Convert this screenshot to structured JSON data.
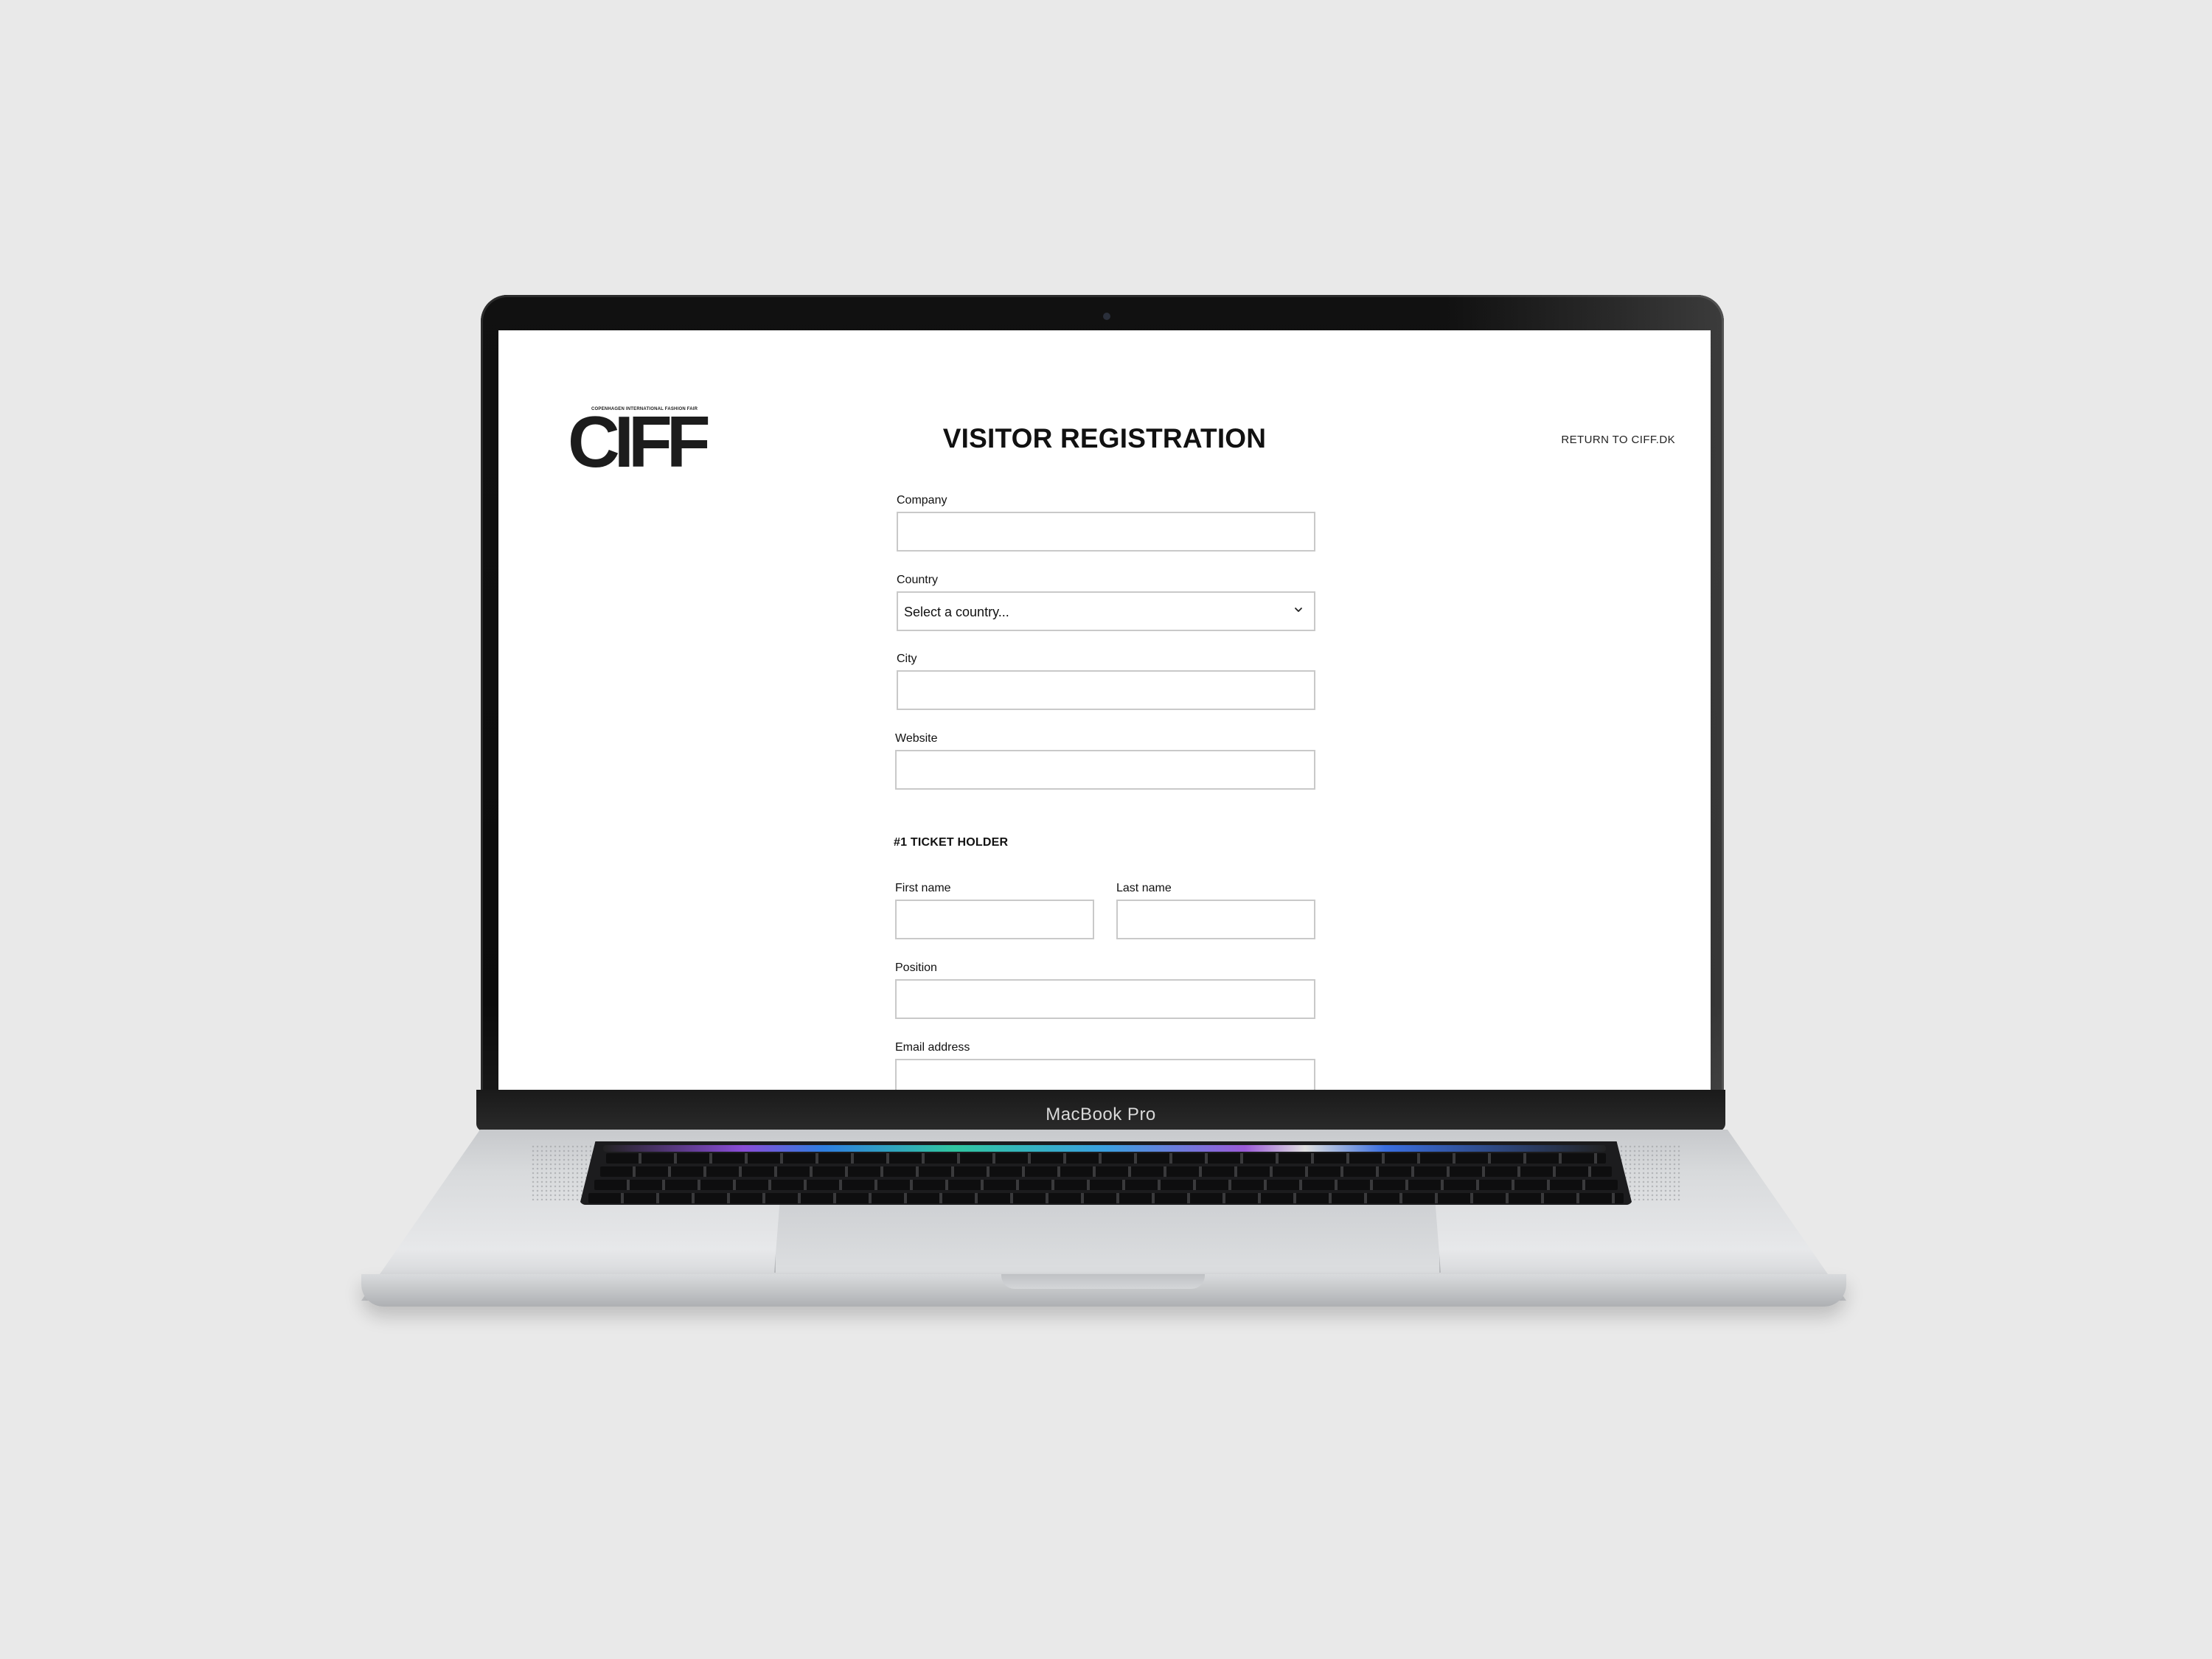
{
  "device": {
    "model_label": "MacBook Pro"
  },
  "page": {
    "logo": {
      "text": "CIFF",
      "tagline": "COPENHAGEN INTERNATIONAL FASHION FAIR"
    },
    "title": "VISITOR REGISTRATION",
    "return_link": "RETURN TO CIFF.DK"
  },
  "form": {
    "company": {
      "label": "Company",
      "value": "",
      "placeholder": ""
    },
    "country": {
      "label": "Country",
      "selected": "Select a country..."
    },
    "city": {
      "label": "City",
      "value": "",
      "placeholder": ""
    },
    "website": {
      "label": "Website",
      "value": "",
      "placeholder": ""
    },
    "ticket_holder_heading": "#1 TICKET HOLDER",
    "first_name": {
      "label": "First name",
      "value": "",
      "placeholder": ""
    },
    "last_name": {
      "label": "Last name",
      "value": "",
      "placeholder": ""
    },
    "position": {
      "label": "Position",
      "value": "",
      "placeholder": ""
    },
    "email": {
      "label": "Email address",
      "value": "",
      "placeholder": ""
    }
  },
  "colors": {
    "background": "#e9e9e9",
    "screen": "#ffffff",
    "text": "#111111",
    "input_border": "#c9c9c9"
  }
}
